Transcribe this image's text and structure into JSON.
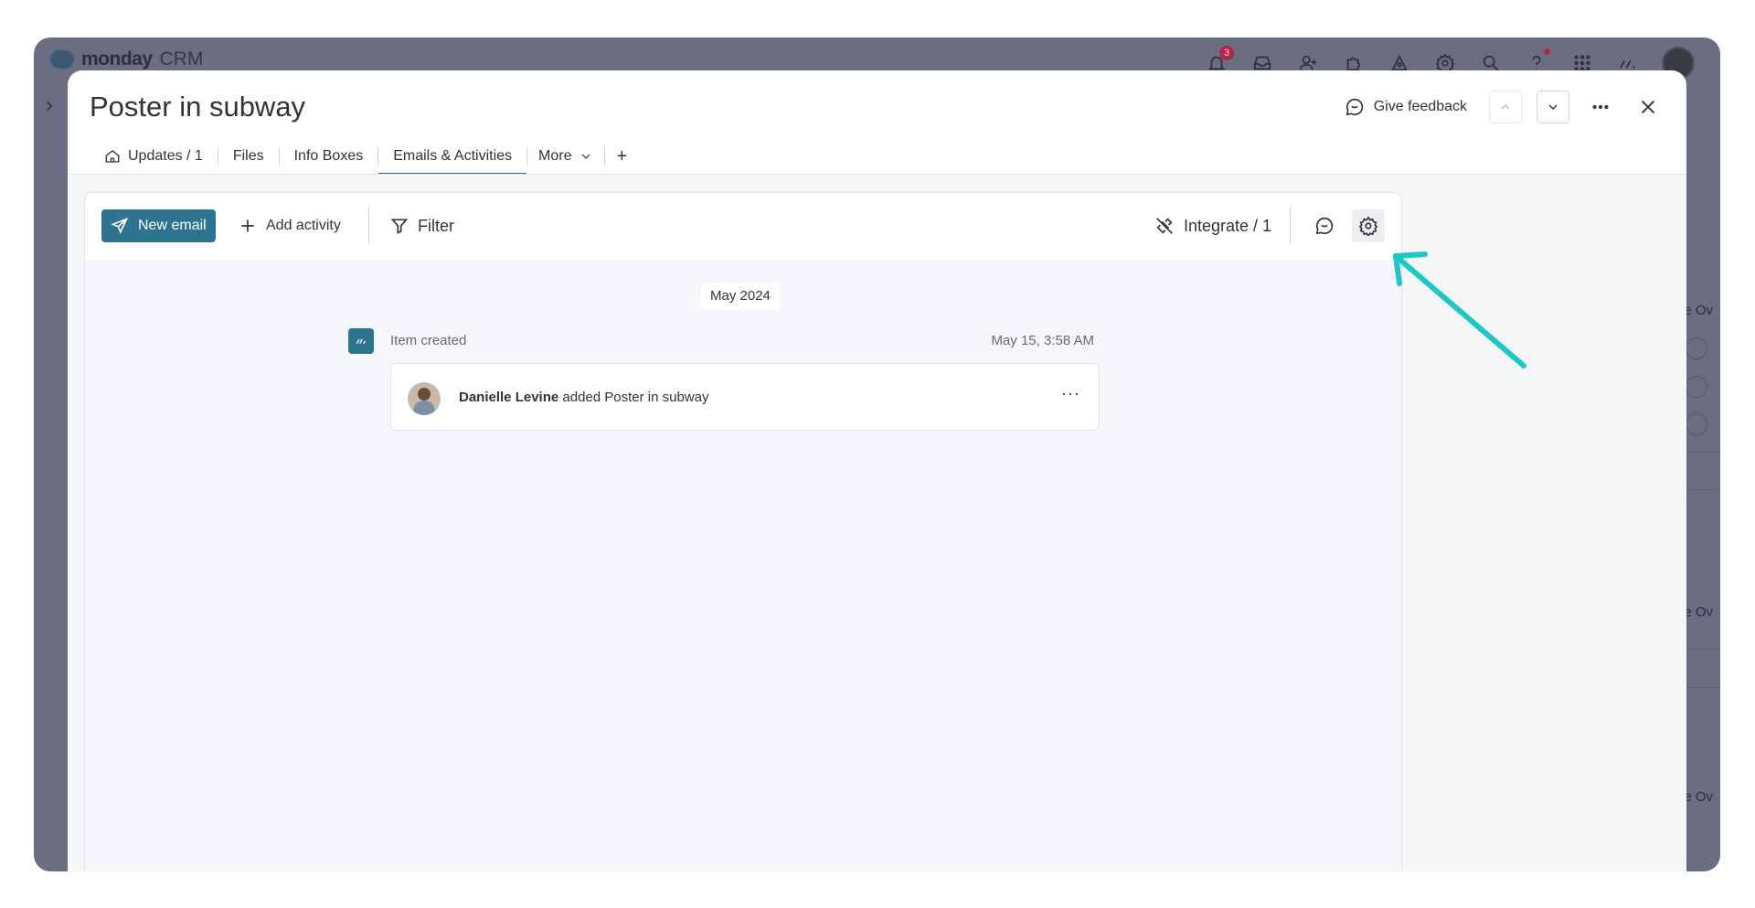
{
  "app": {
    "brand_name": "monday",
    "brand_suffix": "CRM",
    "notification_count": "3"
  },
  "background": {
    "row_label": "e Ov"
  },
  "panel": {
    "title": "Poster in subway",
    "feedback_label": "Give feedback"
  },
  "tabs": [
    {
      "label": "Updates / 1",
      "icon": "home-icon"
    },
    {
      "label": "Files"
    },
    {
      "label": "Info Boxes"
    },
    {
      "label": "Emails & Activities",
      "active": true
    },
    {
      "label": "More",
      "icon": "chevron-down-icon"
    },
    {
      "label": "+"
    }
  ],
  "toolbar": {
    "new_email_label": "New email",
    "add_activity_label": "Add activity",
    "filter_label": "Filter",
    "integrate_label": "Integrate / 1"
  },
  "timeline": {
    "month": "May 2024",
    "item": {
      "title": "Item created",
      "date": "May 15, 3:58 AM",
      "user": "Danielle Levine",
      "action": " added Poster in subway",
      "more": "···"
    }
  },
  "colors": {
    "accent": "#2d7490",
    "arrow": "#1cc8c4",
    "badge": "#b0264a"
  }
}
